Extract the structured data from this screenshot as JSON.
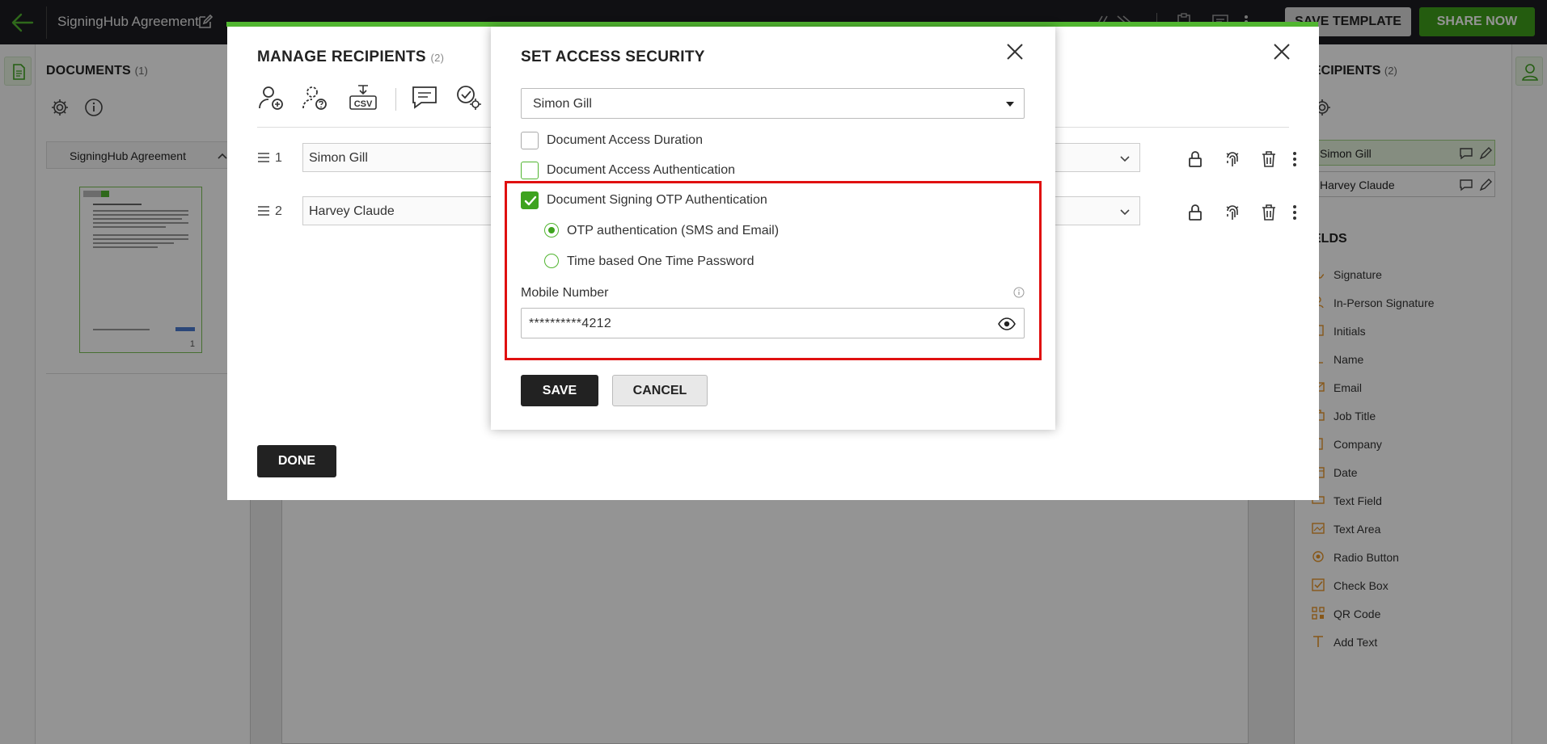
{
  "topbar": {
    "document_title": "SigningHub Agreement",
    "save_template_label": "SAVE TEMPLATE",
    "share_now_label": "SHARE NOW"
  },
  "left_panel": {
    "title": "DOCUMENTS",
    "count": "(1)",
    "document_name": "SigningHub Agreement",
    "thumbnail_page": "1"
  },
  "right_panel": {
    "recipients_title": "ECIPIENTS",
    "recipients_count": "(2)",
    "recipients": [
      "Simon Gill",
      "Harvey Claude"
    ],
    "fields_title": "ELDS",
    "fields": [
      {
        "label": "Signature",
        "icon": "signature-icon"
      },
      {
        "label": "In-Person Signature",
        "icon": "in-person-signature-icon"
      },
      {
        "label": "Initials",
        "icon": "initials-icon"
      },
      {
        "label": "Name",
        "icon": "name-icon"
      },
      {
        "label": "Email",
        "icon": "email-icon"
      },
      {
        "label": "Job Title",
        "icon": "job-title-icon"
      },
      {
        "label": "Company",
        "icon": "company-icon"
      },
      {
        "label": "Date",
        "icon": "date-icon"
      },
      {
        "label": "Text Field",
        "icon": "text-field-icon"
      },
      {
        "label": "Text Area",
        "icon": "text-area-icon"
      },
      {
        "label": "Radio Button",
        "icon": "radio-button-icon"
      },
      {
        "label": "Check Box",
        "icon": "check-box-icon"
      },
      {
        "label": "QR Code",
        "icon": "qr-code-icon"
      },
      {
        "label": "Add Text",
        "icon": "add-text-icon"
      }
    ]
  },
  "manage_recipients": {
    "title": "MANAGE RECIPIENTS",
    "count": "(2)",
    "tools": [
      "add-recipient-icon",
      "add-placeholder-icon",
      "import-csv-icon",
      "comment-icon",
      "approval-settings-icon"
    ],
    "csv_label": "CSV",
    "rows": [
      {
        "number": "1",
        "name": "Simon Gill"
      },
      {
        "number": "2",
        "name": "Harvey Claude"
      }
    ],
    "done_label": "DONE"
  },
  "access_security": {
    "title": "SET ACCESS SECURITY",
    "selected_recipient": "Simon Gill",
    "options": [
      {
        "label": "Document Access Duration",
        "checked": false
      },
      {
        "label": "Document Access Authentication",
        "checked": false
      },
      {
        "label": "Document Signing OTP Authentication",
        "checked": true
      }
    ],
    "otp_methods": [
      {
        "label": "OTP authentication (SMS and Email)",
        "selected": true
      },
      {
        "label": "Time based One Time Password",
        "selected": false
      }
    ],
    "mobile_label": "Mobile Number",
    "mobile_value": "**********4212",
    "save_label": "SAVE",
    "cancel_label": "CANCEL"
  },
  "colors": {
    "accent_green": "#3ea31f",
    "highlight_red": "#e01010",
    "topbar_bg": "#1c1c22"
  }
}
